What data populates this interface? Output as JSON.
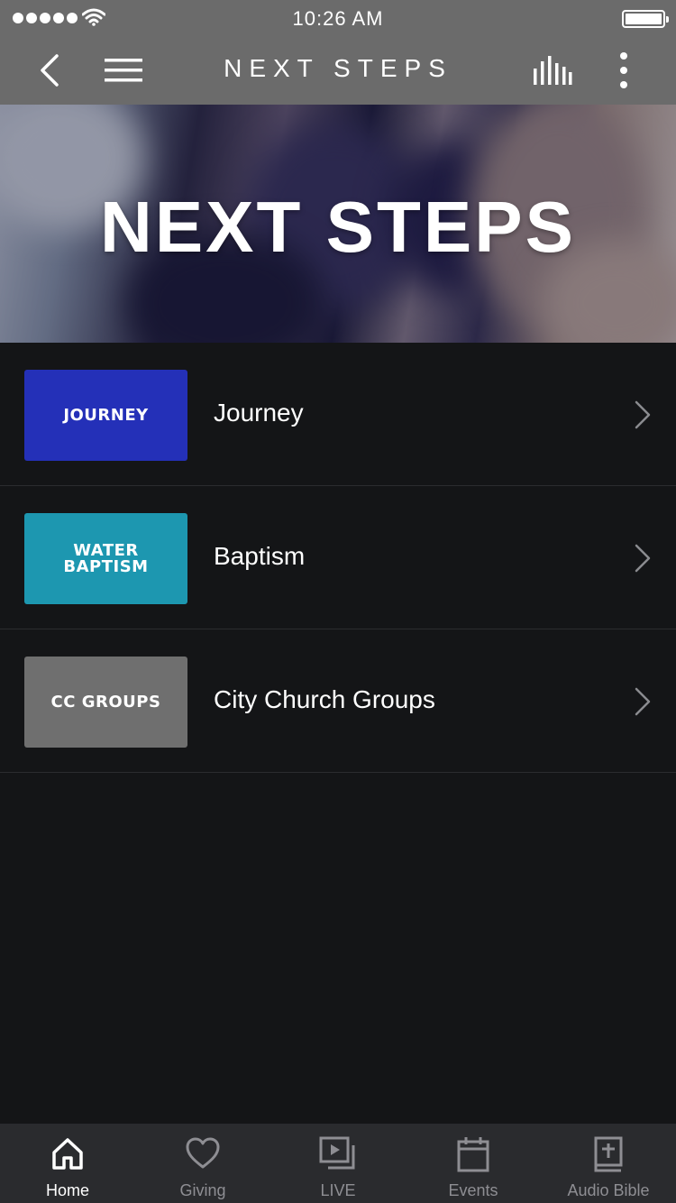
{
  "status_bar": {
    "time": "10:26 AM"
  },
  "nav": {
    "title": "NEXT STEPS",
    "back_icon": "chevron-left-icon",
    "menu_icon": "hamburger-icon",
    "audio_icon": "equalizer-icon",
    "more_icon": "more-vertical-icon"
  },
  "hero": {
    "title": "NEXT STEPS"
  },
  "items": [
    {
      "thumb_text": "JOURNEY",
      "thumb_color": "#2430b8",
      "label": "Journey"
    },
    {
      "thumb_text": "WATER\nBAPTISM",
      "thumb_color": "#1d97b0",
      "label": "Baptism"
    },
    {
      "thumb_text": "CC GROUPS",
      "thumb_color": "#6f6f6f",
      "label": "City Church Groups"
    }
  ],
  "tabs": [
    {
      "label": "Home",
      "icon": "home-icon",
      "active": true
    },
    {
      "label": "Giving",
      "icon": "heart-icon",
      "active": false
    },
    {
      "label": "LIVE",
      "icon": "video-play-icon",
      "active": false
    },
    {
      "label": "Events",
      "icon": "calendar-icon",
      "active": false
    },
    {
      "label": "Audio Bible",
      "icon": "bible-icon",
      "active": false
    }
  ],
  "colors": {
    "bar_bg": "#6b6b6b",
    "list_bg": "#141517",
    "tabbar_bg": "#2a2b2e",
    "tab_active": "#ffffff",
    "tab_inactive": "#8e8e93"
  }
}
